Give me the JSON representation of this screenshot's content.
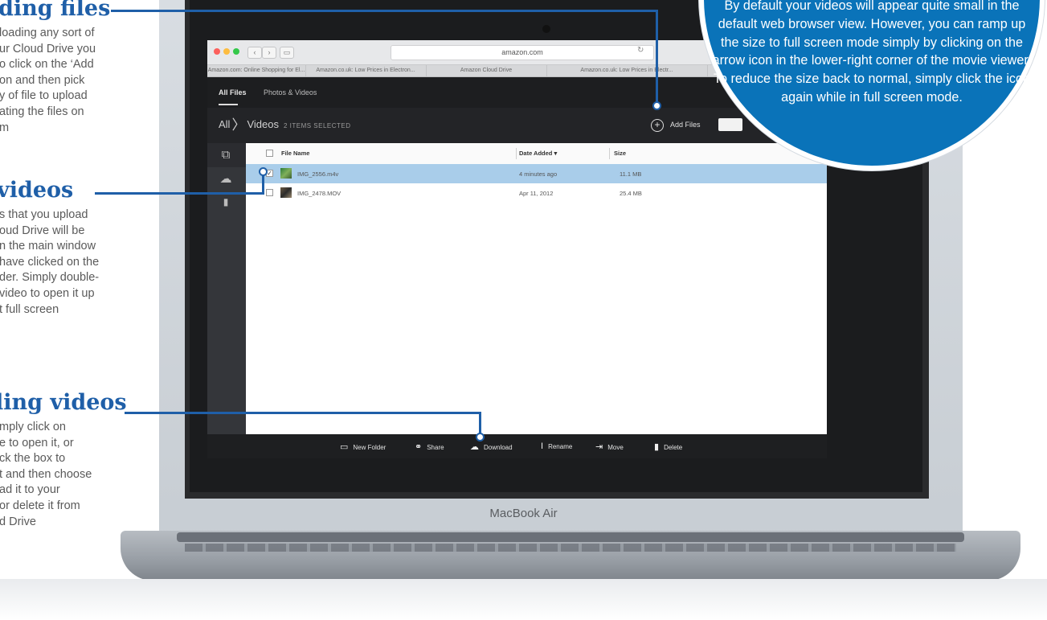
{
  "annotations": [
    {
      "heading": "ding files",
      "body": "loading any sort of\nur Cloud Drive you\no click on the ‘Add\non and then pick\ny of file to upload\nating the files on\nm"
    },
    {
      "heading": "videos",
      "body": "s that you upload\noud Drive will be\nn the main window\nhave clicked on the\nder. Simply double-\nvideo to open it up\nt full screen"
    },
    {
      "heading": "ling videos",
      "body": "mply click on\ne to open it, or\nck the box to\nt and then choose\nad it to your\n or delete it from\nd Drive"
    }
  ],
  "bubble": {
    "text": "By default your videos will appear quite small in the default web browser view. However, you can ramp up the size to full screen mode simply by clicking on the arrow icon in the lower-right corner of the movie viewer. To reduce the size back to normal, simply click the icon again while in full screen mode."
  },
  "laptop": {
    "brand": "MacBook Air"
  },
  "browser": {
    "url": "amazon.com",
    "tabs": [
      "Amazon.com: Online Shopping for El...",
      "Amazon.co.uk: Low Prices in Electron...",
      "Amazon Cloud Drive",
      "Amazon.co.uk: Low Prices in Electr..."
    ]
  },
  "app": {
    "nav": {
      "all_files": "All Files",
      "photos_videos": "Photos & Videos"
    },
    "breadcrumb": {
      "root": "All",
      "folder": "Videos",
      "count": "2 ITEMS SELECTED"
    },
    "add_files": "Add Files",
    "columns": {
      "name": "File Name",
      "date": "Date Added ▾",
      "size": "Size"
    },
    "files": [
      {
        "name": "IMG_2556.m4v",
        "date": "4 minutes ago",
        "size": "11.1 MB",
        "selected": true
      },
      {
        "name": "IMG_2478.MOV",
        "date": "Apr 11, 2012",
        "size": "25.4 MB",
        "selected": false
      }
    ],
    "toolbar": {
      "new_folder": "New Folder",
      "share": "Share",
      "download": "Download",
      "rename": "Rename",
      "move": "Move",
      "delete": "Delete"
    }
  },
  "colors": {
    "accent": "#1f5fa8",
    "bubble": "#0a73b9",
    "selected_row": "#a9cdea"
  }
}
